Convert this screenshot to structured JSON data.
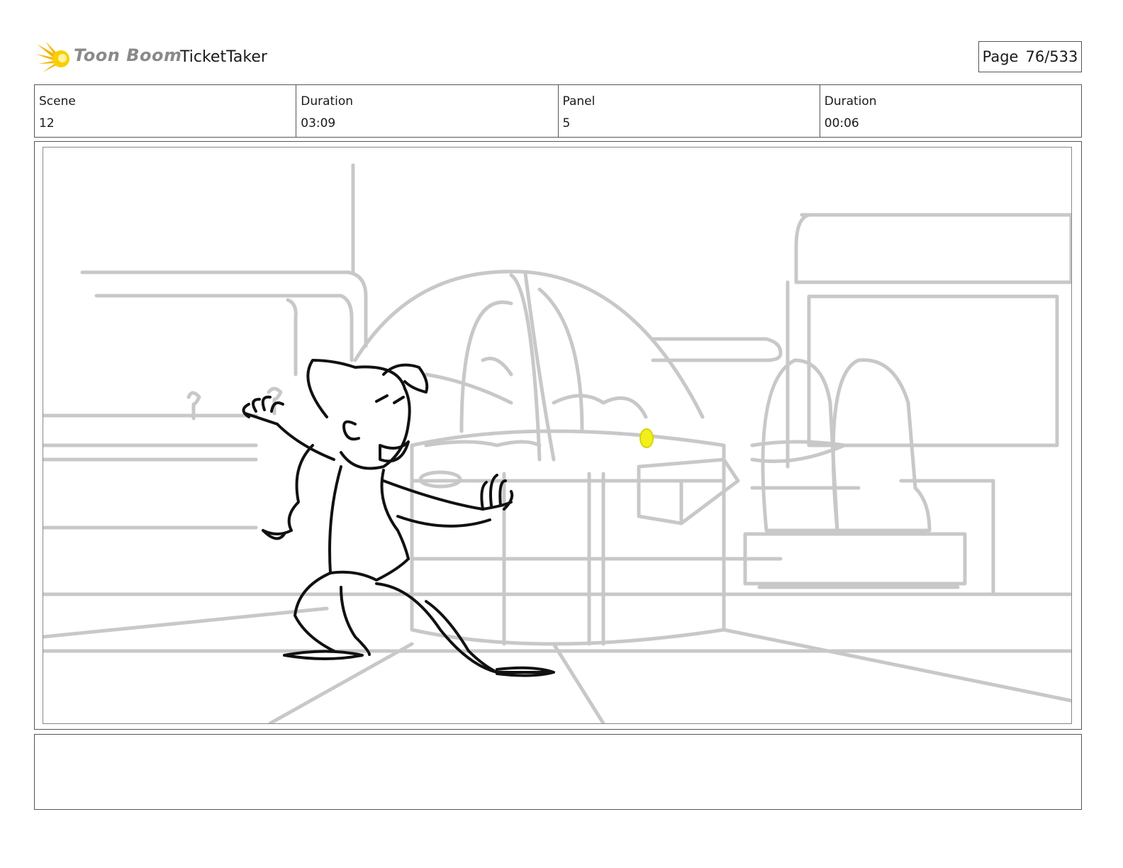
{
  "header": {
    "logo_text": "Toon Boom",
    "project_title": "TicketTaker",
    "page_label": "Page",
    "page_number": "76/533"
  },
  "info": {
    "scene_label": "Scene",
    "scene_value": "12",
    "scene_duration_label": "Duration",
    "scene_duration_value": "03:09",
    "panel_label": "Panel",
    "panel_value": "5",
    "panel_duration_label": "Duration",
    "panel_duration_value": "00:06"
  },
  "notes": {
    "text": ""
  },
  "colors": {
    "sketch_gray": "#c4c4c4",
    "ink": "#111111",
    "highlight_yellow": "#f2ef1c",
    "logo_orange": "#f5a800"
  }
}
